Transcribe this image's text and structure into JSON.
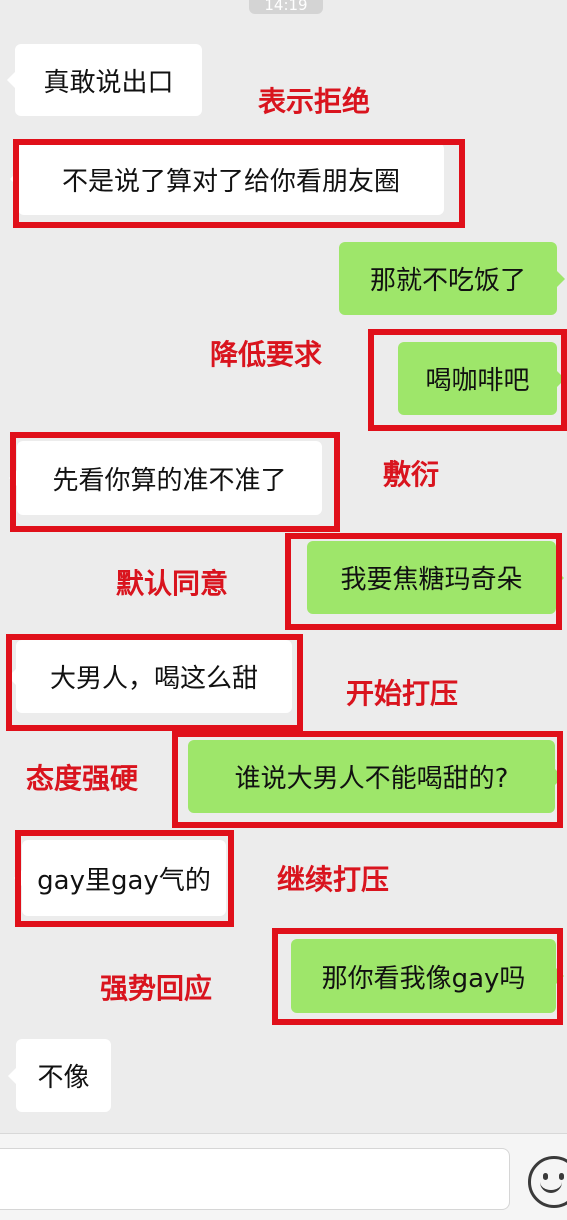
{
  "status_time": "14:19",
  "messages": [
    {
      "side": "left",
      "text": "真敢说出口"
    },
    {
      "side": "left",
      "text": "不是说了算对了给你看朋友圈"
    },
    {
      "side": "right",
      "text": "那就不吃饭了"
    },
    {
      "side": "right",
      "text": "喝咖啡吧"
    },
    {
      "side": "left",
      "text": "先看你算的准不准了"
    },
    {
      "side": "right",
      "text": "我要焦糖玛奇朵"
    },
    {
      "side": "left",
      "text": "大男人，喝这么甜"
    },
    {
      "side": "right",
      "text": "谁说大男人不能喝甜的?"
    },
    {
      "side": "left",
      "text": "gay里gay气的"
    },
    {
      "side": "right",
      "text": "那你看我像gay吗"
    },
    {
      "side": "left",
      "text": "不像"
    }
  ],
  "annotations": [
    "表示拒绝",
    "降低要求",
    "敷衍",
    "默认同意",
    "开始打压",
    "态度强硬",
    "继续打压",
    "强势回应"
  ],
  "colors": {
    "background": "#ececec",
    "incoming_bubble": "#ffffff",
    "outgoing_bubble": "#9ee66a",
    "annotation_red": "#e0101a"
  },
  "icons": {
    "emoji_button": "smiley-face-icon"
  }
}
